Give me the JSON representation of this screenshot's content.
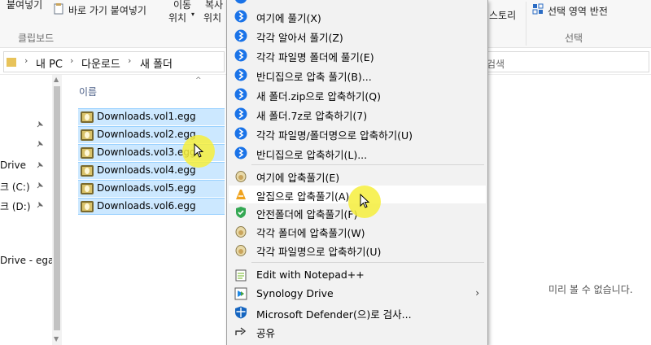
{
  "ribbon": {
    "paste_label": "붙여넣기",
    "shortcut_label": "바로 가기 붙여넣기",
    "move_label_top": "이동",
    "move_label_bottom": "위치",
    "copy_label_top": "복사",
    "copy_label_bottom": "위치",
    "clipboard_group": "클립보드",
    "history_label": "스토리",
    "invert_label": "선택 영역 반전",
    "select_group": "선택"
  },
  "address": {
    "crumbs": [
      "내 PC",
      "다운로드",
      "새 폴더"
    ],
    "search_placeholder": "검색"
  },
  "nav": {
    "items": [
      "Drive",
      "크 (C:)",
      "크 (D:)",
      "Drive - ega"
    ]
  },
  "file_list": {
    "column_name": "이름",
    "files": [
      "Downloads.vol1.egg",
      "Downloads.vol2.egg",
      "Downloads.vol3.egg",
      "Downloads.vol4.egg",
      "Downloads.vol5.egg",
      "Downloads.vol6.egg"
    ],
    "preview_message": "미리 볼 수 없습니다."
  },
  "context_menu": {
    "bandizip_items": [
      "여기에 풀기(X)",
      "각각 알아서 풀기(Z)",
      "각각 파일명 폴더에 풀기(E)",
      "반디집으로 압축 풀기(B)...",
      "새 폴더.zip으로 압축하기(Q)",
      "새 폴더.7z로 압축하기(7)",
      "각각 파일명/폴더명으로 압축하기(U)",
      "반디집으로 압축하기(L)..."
    ],
    "alzip_items": [
      "여기에 압축풀기(E)",
      "알집으로 압축풀기(A)",
      "안전폴더에 압축풀기(F)",
      "각각 폴더에 압축풀기(W)",
      "각각 파일명으로 압축하기(U)"
    ],
    "other_items": [
      "Edit with Notepad++",
      "Synology Drive",
      "Microsoft Defender(으)로 검사...",
      "공유"
    ],
    "submenu_arrow": "›"
  },
  "colors": {
    "selection_fill": "#cce8ff",
    "bandizip_blue": "#1a73e8",
    "cursor_highlight": "#f6ee3c"
  }
}
